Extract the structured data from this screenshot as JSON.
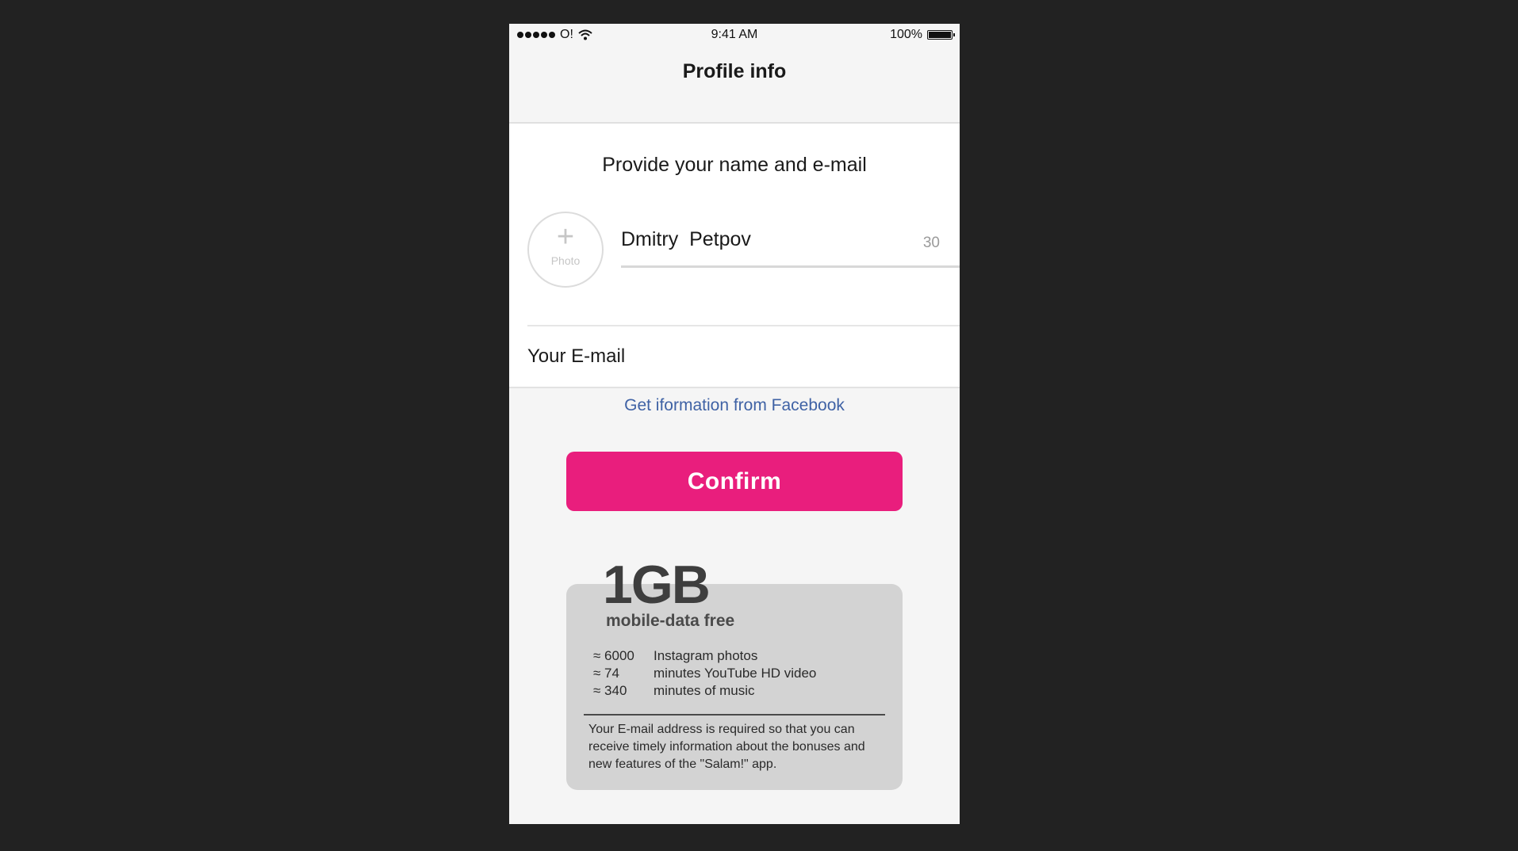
{
  "status_bar": {
    "carrier": "O!",
    "time": "9:41 AM",
    "battery": "100%",
    "icons": [
      "signal-dots-icon",
      "wifi-icon",
      "battery-icon"
    ]
  },
  "nav": {
    "title": "Profile info"
  },
  "form": {
    "heading": "Provide your name and e-mail",
    "photo_label": "Photo",
    "photo_icon": "plus-icon",
    "name_value": "Dmitry  Petpov",
    "name_counter": "30",
    "email_placeholder": "Your E-mail"
  },
  "facebook_link": "Get iformation from Facebook",
  "confirm_label": "Confirm",
  "promo": {
    "amount": "1GB",
    "subtitle": "mobile-data free",
    "stats": [
      {
        "value": "≈ 6000",
        "label": "Instagram photos"
      },
      {
        "value": "≈ 74",
        "label": "minutes YouTube HD video"
      },
      {
        "value": "≈ 340",
        "label": "minutes of music"
      }
    ],
    "note": "Your E-mail address is required so that you can receive timely information about the bonuses and new features of the \"Salam!\" app."
  },
  "colors": {
    "background": "#222222",
    "accent": "#e91e7d",
    "link": "#3f62a5",
    "card": "#d3d3d3"
  }
}
